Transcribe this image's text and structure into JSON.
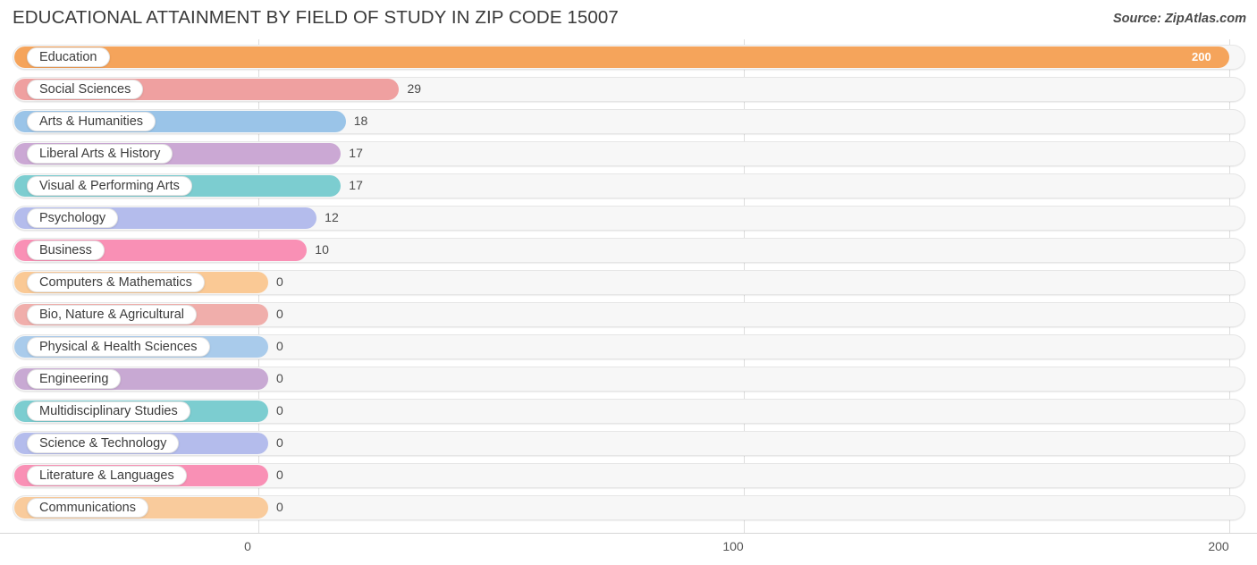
{
  "header": {
    "title": "EDUCATIONAL ATTAINMENT BY FIELD OF STUDY IN ZIP CODE 15007",
    "source": "Source: ZipAtlas.com"
  },
  "chart_data": {
    "type": "bar",
    "orientation": "horizontal",
    "title": "EDUCATIONAL ATTAINMENT BY FIELD OF STUDY IN ZIP CODE 15007",
    "xlabel": "",
    "ylabel": "",
    "xlim": [
      0,
      200
    ],
    "xticks": [
      0,
      100,
      200
    ],
    "xtick_labels": [
      "0",
      "100",
      "200"
    ],
    "grid": true,
    "legend": "none",
    "categories": [
      "Education",
      "Social Sciences",
      "Arts & Humanities",
      "Liberal Arts & History",
      "Visual & Performing Arts",
      "Psychology",
      "Business",
      "Computers & Mathematics",
      "Bio, Nature & Agricultural",
      "Physical & Health Sciences",
      "Engineering",
      "Multidisciplinary Studies",
      "Science & Technology",
      "Literature & Languages",
      "Communications"
    ],
    "values": [
      200,
      29,
      18,
      17,
      17,
      12,
      10,
      0,
      0,
      0,
      0,
      0,
      0,
      0,
      0
    ],
    "value_labels": [
      "200",
      "29",
      "18",
      "17",
      "17",
      "12",
      "10",
      "0",
      "0",
      "0",
      "0",
      "0",
      "0",
      "0",
      "0"
    ],
    "colors": [
      "#f5a45b",
      "#efa0a0",
      "#9ac4e8",
      "#cba8d4",
      "#7ccdd0",
      "#b4bcec",
      "#f990b5",
      "#fac995",
      "#f0aeab",
      "#a9cbeb",
      "#c8a9d3",
      "#7ccdd0",
      "#b4bcec",
      "#f990b5",
      "#f9cb9c"
    ]
  },
  "colors": {
    "background": "#ffffff",
    "track": "#f7f7f7",
    "track_border": "#e6e6e6",
    "gridline": "#dddddd",
    "text": "#3c3c3c"
  }
}
